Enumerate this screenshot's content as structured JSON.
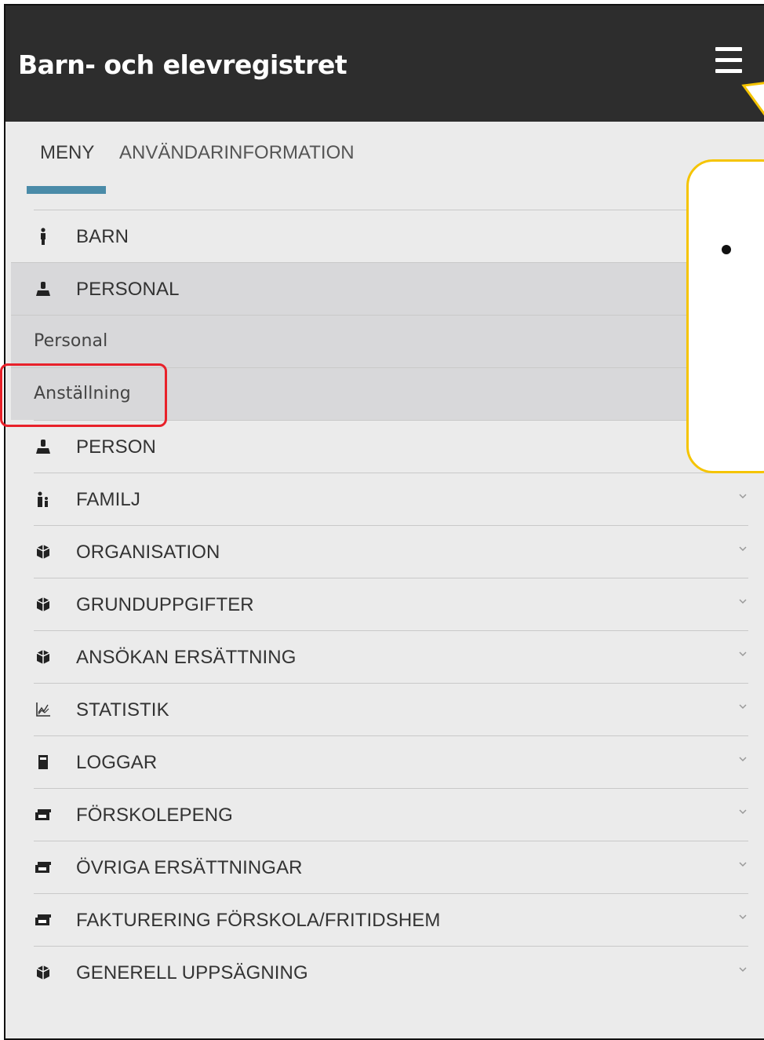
{
  "header": {
    "title": "Barn- och elevregistret"
  },
  "tabs": [
    {
      "label": "MENY",
      "active": true
    },
    {
      "label": "ANVÄNDARINFORMATION",
      "active": false
    }
  ],
  "menu": {
    "items": [
      {
        "label": "BARN",
        "icon": "child-icon"
      },
      {
        "label": "PERSONAL",
        "icon": "person-icon",
        "expanded": true
      },
      {
        "label": "Personal",
        "sub": true
      },
      {
        "label": "Anställning",
        "sub": true
      },
      {
        "label": "PERSON",
        "icon": "person-icon"
      },
      {
        "label": "FAMILJ",
        "icon": "family-icon"
      },
      {
        "label": "ORGANISATION",
        "icon": "cube-icon"
      },
      {
        "label": "GRUNDUPPGIFTER",
        "icon": "cube-icon"
      },
      {
        "label": "ANSÖKAN ERSÄTTNING",
        "icon": "cube-icon"
      },
      {
        "label": "STATISTIK",
        "icon": "chart-icon"
      },
      {
        "label": "LOGGAR",
        "icon": "book-icon"
      },
      {
        "label": "FÖRSKOLEPENG",
        "icon": "money-icon"
      },
      {
        "label": "ÖVRIGA ERSÄTTNINGAR",
        "icon": "money-icon"
      },
      {
        "label": "FAKTURERING FÖRSKOLA/FRITIDSHEM",
        "icon": "money-icon"
      },
      {
        "label": "GENERELL UPPSÄGNING",
        "icon": "cube-icon"
      }
    ]
  },
  "colors": {
    "header_bg": "#2d2d2d",
    "tab_underline": "#4a8ba8",
    "highlight_box": "#e8212a",
    "callout_border": "#f5c400"
  }
}
